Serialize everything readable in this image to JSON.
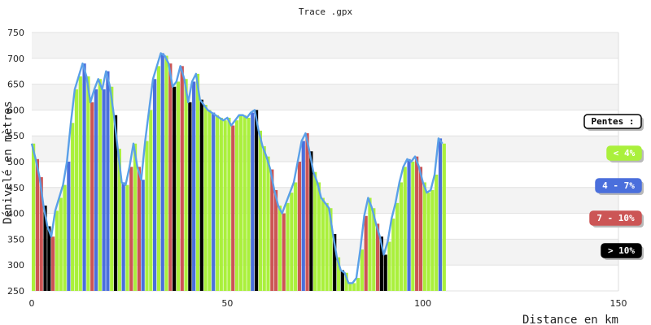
{
  "chart_data": {
    "type": "area",
    "title": "Trace .gpx",
    "xlabel": "Distance en km",
    "ylabel": "Dénivelé en mètres",
    "xlim": [
      0,
      150
    ],
    "ylim": [
      250,
      750
    ],
    "x_ticks": [
      0,
      50,
      100,
      150
    ],
    "y_ticks": [
      250,
      300,
      350,
      400,
      450,
      500,
      550,
      600,
      650,
      700,
      750
    ],
    "grid": true,
    "legend_position": "right",
    "legend": {
      "title": "Pentes :",
      "entries": [
        {
          "label": "< 4%",
          "color": "#aaf03c",
          "text_color": "#ffffff"
        },
        {
          "label": "4 - 7%",
          "color": "#4a6fdc",
          "text_color": "#ffffff"
        },
        {
          "label": "7 - 10%",
          "color": "#cc5555",
          "text_color": "#ffffff"
        },
        {
          "label": "> 10%",
          "color": "#000000",
          "text_color": "#ffffff"
        }
      ]
    },
    "line_color": "#5aa0e8",
    "x": [
      0,
      1,
      2,
      3,
      4,
      5,
      6,
      7,
      8,
      9,
      10,
      11,
      12,
      13,
      14,
      15,
      16,
      17,
      18,
      19,
      20,
      21,
      22,
      23,
      24,
      25,
      26,
      27,
      28,
      29,
      30,
      31,
      32,
      33,
      34,
      35,
      36,
      37,
      38,
      39,
      40,
      41,
      42,
      43,
      44,
      45,
      46,
      47,
      48,
      49,
      50,
      51,
      52,
      53,
      54,
      55,
      56,
      57,
      58,
      59,
      60,
      61,
      62,
      63,
      64,
      65,
      66,
      67,
      68,
      69,
      70,
      71,
      72,
      73,
      74,
      75,
      76,
      77,
      78,
      79,
      80,
      81,
      82,
      83,
      84,
      85,
      86,
      87,
      88,
      89,
      90,
      91,
      92,
      93,
      94,
      95,
      96,
      97,
      98,
      99,
      100,
      101,
      102,
      103,
      104,
      105
    ],
    "y": [
      535,
      505,
      470,
      415,
      375,
      355,
      405,
      430,
      455,
      500,
      575,
      640,
      665,
      690,
      665,
      615,
      640,
      660,
      640,
      675,
      645,
      590,
      525,
      460,
      455,
      490,
      535,
      490,
      465,
      540,
      600,
      660,
      685,
      710,
      705,
      690,
      645,
      655,
      685,
      660,
      615,
      655,
      670,
      620,
      610,
      600,
      595,
      590,
      585,
      580,
      585,
      570,
      580,
      590,
      590,
      585,
      595,
      600,
      560,
      530,
      510,
      485,
      445,
      415,
      400,
      420,
      440,
      460,
      500,
      540,
      555,
      520,
      480,
      460,
      430,
      420,
      410,
      360,
      315,
      290,
      285,
      265,
      265,
      275,
      330,
      395,
      430,
      410,
      380,
      355,
      320,
      345,
      390,
      420,
      460,
      490,
      505,
      500,
      510,
      490,
      460,
      440,
      445,
      475,
      545,
      535
    ],
    "slope": [
      0,
      2,
      2,
      3,
      3,
      2,
      0,
      0,
      0,
      1,
      0,
      0,
      0,
      1,
      0,
      2,
      1,
      0,
      1,
      1,
      0,
      3,
      0,
      1,
      0,
      2,
      0,
      2,
      1,
      0,
      0,
      1,
      0,
      1,
      0,
      2,
      3,
      0,
      2,
      0,
      3,
      1,
      0,
      3,
      0,
      0,
      1,
      0,
      0,
      0,
      0,
      2,
      0,
      0,
      0,
      0,
      1,
      3,
      0,
      0,
      0,
      2,
      2,
      0,
      2,
      0,
      0,
      0,
      2,
      1,
      2,
      3,
      0,
      0,
      0,
      0,
      0,
      3,
      0,
      3,
      0,
      0,
      0,
      0,
      0,
      2,
      0,
      0,
      2,
      3,
      3,
      0,
      0,
      0,
      0,
      0,
      1,
      0,
      2,
      2,
      0,
      0,
      0,
      0,
      1,
      0
    ]
  }
}
